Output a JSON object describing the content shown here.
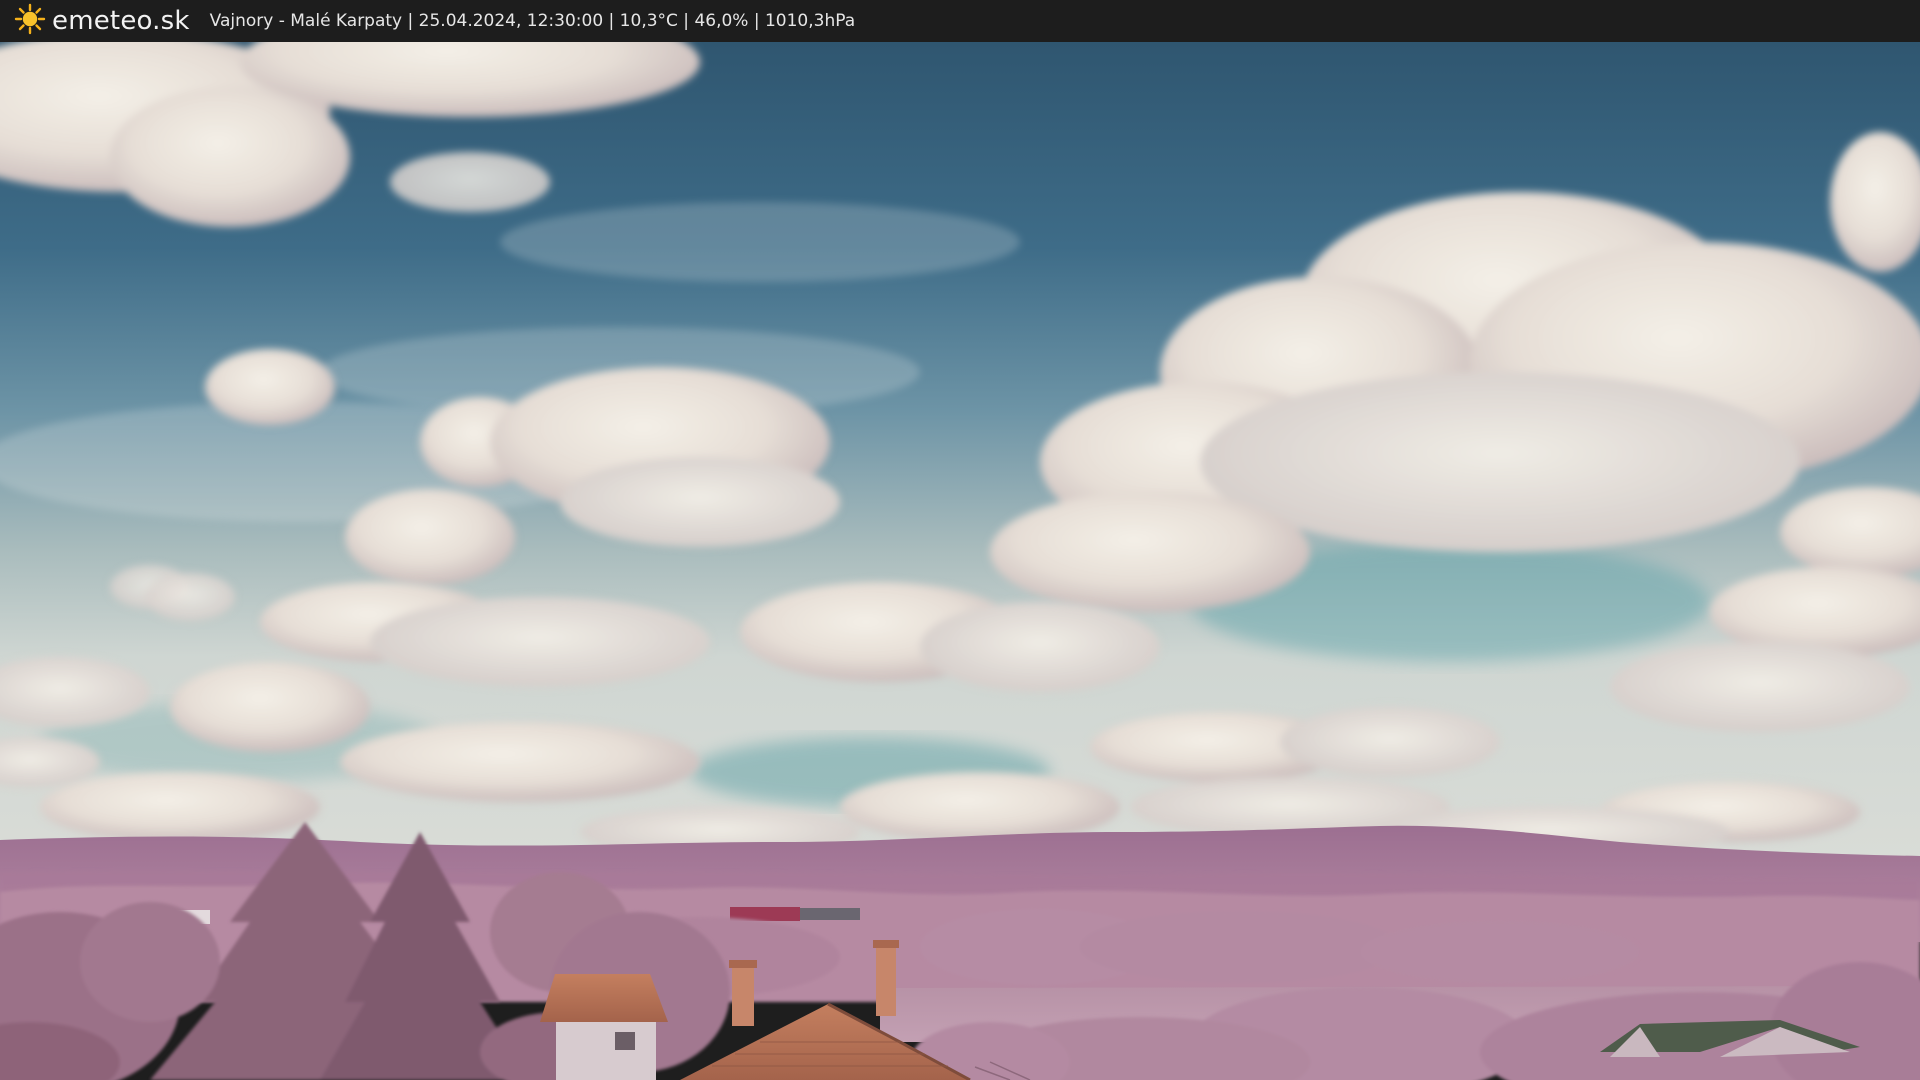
{
  "header": {
    "logo_text": "emeteo.sk",
    "caption": "Vajnory - Malé Karpaty | 25.04.2024, 12:30:00 | 10,3°C | 46,0% | 1010,3hPa",
    "logo_icon": "sun-icon"
  },
  "colors": {
    "bar": "#1d1d1d",
    "sky_top": "#2f5672",
    "sky_horizon": "#cfd6d2",
    "hills": "#a47a98",
    "foliage": "#a97a92",
    "roof": "#b06a4e"
  }
}
